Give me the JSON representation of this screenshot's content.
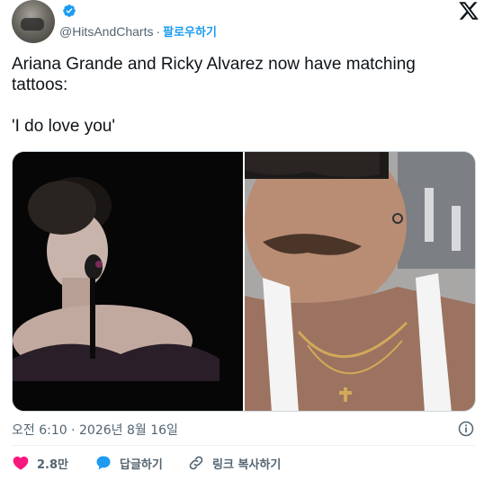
{
  "header": {
    "handle": "@HitsAndCharts",
    "separator": "·",
    "follow_label": "팔로우하기",
    "verified_color": "#1d9bf0"
  },
  "tweet": {
    "line1": "Ariana Grande and Ricky Alvarez now have matching tattoos:",
    "line2": "'I do love you'"
  },
  "media": {
    "photos": [
      "photo-left",
      "photo-right"
    ]
  },
  "meta": {
    "timestamp": "오전 6:10 · 2026년 8월 16일"
  },
  "actions": {
    "likes": "2.8만",
    "reply_label": "답글하기",
    "copy_link_label": "링크 복사하기",
    "like_color": "#f91880",
    "reply_color": "#1d9bf0"
  },
  "icons": [
    "avatar",
    "verified-icon",
    "x-logo-icon",
    "info-icon",
    "heart-icon",
    "reply-bubble-icon",
    "link-icon"
  ]
}
